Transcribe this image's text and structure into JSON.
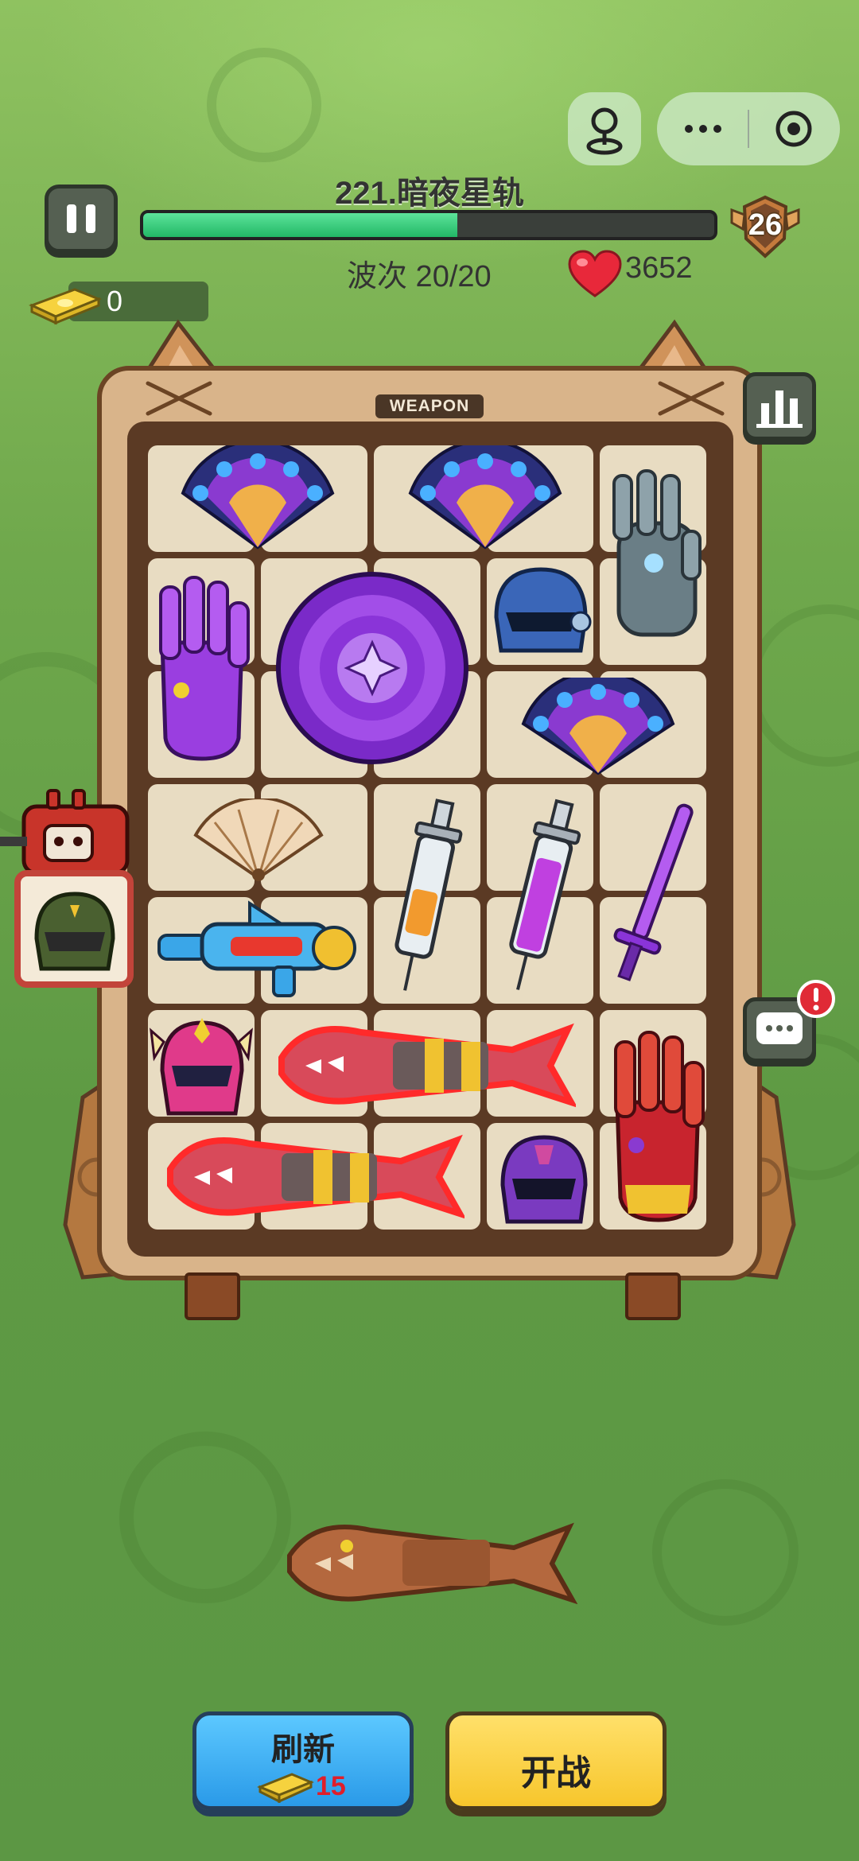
{
  "level": {
    "title": "221.暗夜星轨",
    "progress": 0.55,
    "badge": "26"
  },
  "wave": {
    "text": "波次 20/20"
  },
  "hp": {
    "value": "3652"
  },
  "cash": {
    "value": "0"
  },
  "board": {
    "label": "WEAPON"
  },
  "items": [
    {
      "name": "peacock-fan-icon"
    },
    {
      "name": "peacock-fan-icon"
    },
    {
      "name": "stone-gauntlet-icon"
    },
    {
      "name": "purple-gauntlet-icon"
    },
    {
      "name": "purple-shield-icon"
    },
    {
      "name": "blue-helmet-icon"
    },
    {
      "name": "peacock-fan-icon"
    },
    {
      "name": "paper-fan-icon"
    },
    {
      "name": "syringe-icon"
    },
    {
      "name": "purple-syringe-icon"
    },
    {
      "name": "purple-sword-icon"
    },
    {
      "name": "shark-water-gun-icon"
    },
    {
      "name": "pink-winged-helmet-icon"
    },
    {
      "name": "shark-blade-icon"
    },
    {
      "name": "red-gauntlet-icon"
    },
    {
      "name": "shark-blade-icon"
    },
    {
      "name": "violet-helmet-icon"
    }
  ],
  "buttons": {
    "refresh_label": "刷新",
    "refresh_cost": "15",
    "fight_label": "开战"
  },
  "colors": {
    "progress": "#22b866",
    "refresh": "#2a9ae8",
    "fight": "#f7c62c",
    "cost": "#e01e2a"
  }
}
